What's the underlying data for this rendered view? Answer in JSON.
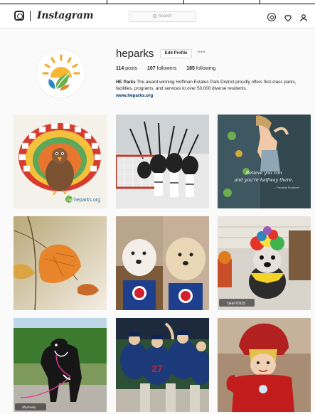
{
  "header": {
    "wordmark": "Instagram",
    "search_placeholder": "Search",
    "icons": [
      "instagram-camera-icon",
      "search-icon",
      "compass-icon",
      "heart-icon",
      "person-icon"
    ]
  },
  "profile": {
    "username": "heparks",
    "edit_label": "Edit Profile",
    "more_label": "•••",
    "stats": {
      "posts": {
        "value": "114",
        "label": "posts"
      },
      "followers": {
        "value": "107",
        "label": "followers"
      },
      "following": {
        "value": "185",
        "label": "following"
      }
    },
    "bio_name": "HE Parks",
    "bio_text": "The award-winning Hoffman Estates Park District proudly offers first-class parks, facilities, programs, and services to over 50,000 diverse residents.",
    "website": "www.heparks.org",
    "avatar_colors": {
      "sun": "#f5a623",
      "leaf_green": "#6ab04c",
      "leaf_blue": "#2e86c1",
      "leaf_orange": "#e67e22"
    }
  },
  "posts": [
    {
      "subject": "paper handprint turkey craft",
      "caption_overlay": "heparks.org",
      "watermark_mark": "he"
    },
    {
      "subject": "youth hockey team celebrating"
    },
    {
      "subject": "child climbing rock wall",
      "caption_overlay": "Believe you can and you're halfway there.",
      "caption_credit": "— Theodore Roosevelt"
    },
    {
      "subject": "autumn leaves"
    },
    {
      "subject": "two fluffy dogs in Cubs jerseys"
    },
    {
      "subject": "dog with Halloween wig",
      "tag": "bean70515"
    },
    {
      "subject": "great dane on leash",
      "tag": "dfryhavily"
    },
    {
      "subject": "baseball team celebrating",
      "jersey_number": "27"
    },
    {
      "subject": "child in superhero costume"
    }
  ]
}
